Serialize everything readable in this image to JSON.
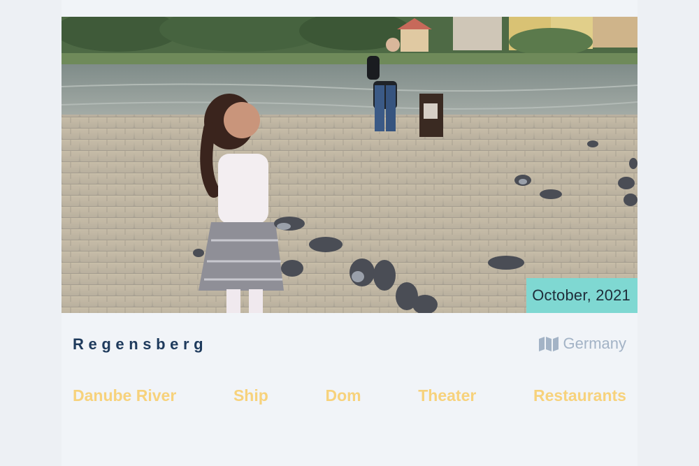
{
  "photo": {
    "alt_icon": "photo-image",
    "date_label": "October, 2021"
  },
  "place": {
    "city": "Regensberg",
    "country": "Germany",
    "country_icon": "map-icon"
  },
  "tags": [
    {
      "label": "Danube River"
    },
    {
      "label": "Ship"
    },
    {
      "label": "Dom"
    },
    {
      "label": "Theater"
    },
    {
      "label": "Restaurants"
    }
  ],
  "colors": {
    "background": "#edf0f4",
    "card": "#f1f4f8",
    "badge": "#7fd8d2",
    "city_text": "#1e3a5c",
    "country_text": "#a3b3c6",
    "tag_text": "#f7d27c"
  }
}
